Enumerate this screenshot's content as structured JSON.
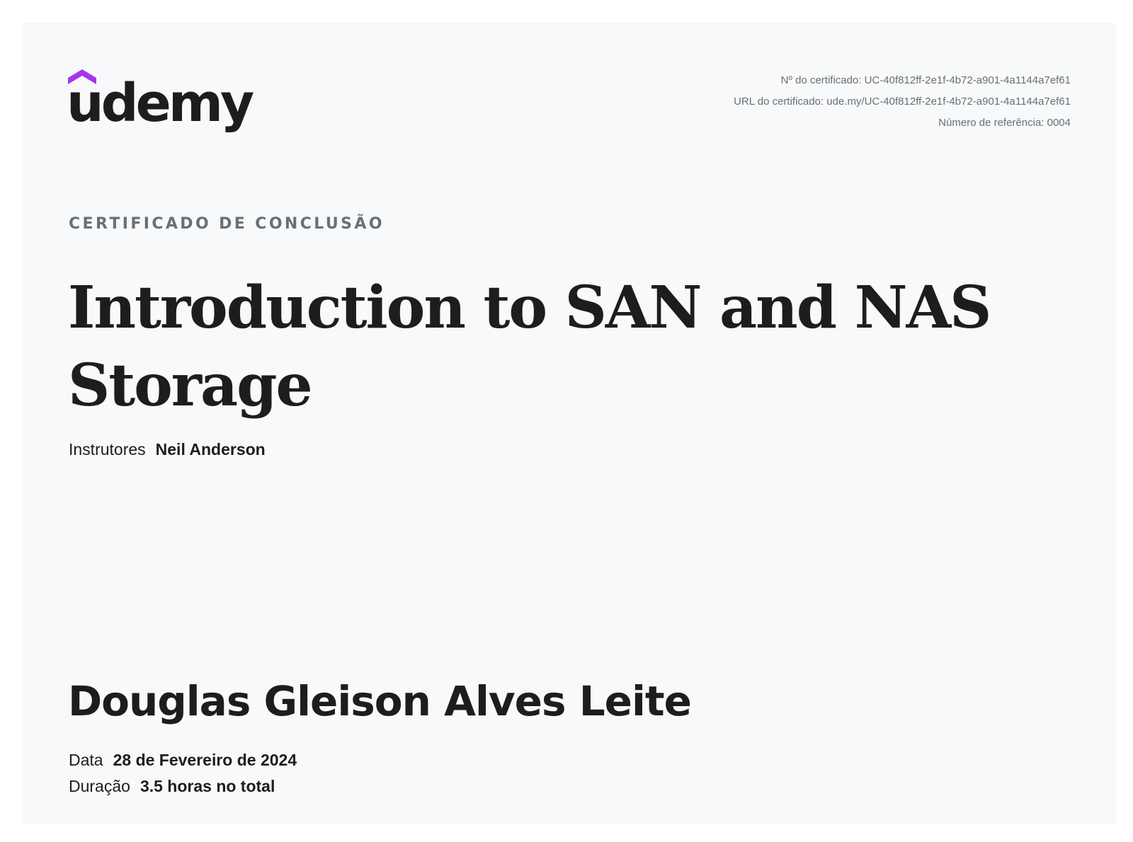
{
  "brand": {
    "name": "udemy",
    "accent_color": "#a435f0",
    "text_color": "#1c1d1f"
  },
  "meta": {
    "certificate_no": "Nº do certificado: UC-40f812ff-2e1f-4b72-a901-4a1144a7ef61",
    "certificate_url": "URL do certificado: ude.my/UC-40f812ff-2e1f-4b72-a901-4a1144a7ef61",
    "reference_no": "Número de referência: 0004"
  },
  "kicker": "CERTIFICADO DE CONCLUSÃO",
  "course_title": "Introduction to SAN and NAS Storage",
  "instructors": {
    "label": "Instrutores",
    "value": "Neil Anderson"
  },
  "student_name": "Douglas Gleison Alves Leite",
  "details": {
    "date_label": "Data",
    "date_value": "28 de Fevereiro de 2024",
    "duration_label": "Duração",
    "duration_value": "3.5 horas no total"
  }
}
